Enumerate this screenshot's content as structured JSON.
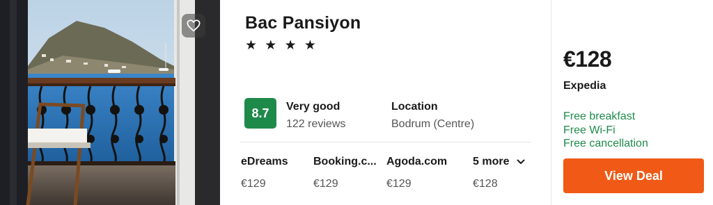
{
  "hotel": {
    "name": "Bac Pansiyon",
    "stars": "★ ★ ★ ★",
    "score": "8.7",
    "rating_label": "Very good",
    "reviews": "122 reviews",
    "location_label": "Location",
    "location_value": "Bodrum (Centre)"
  },
  "providers": [
    {
      "name": "eDreams",
      "price": "€129"
    },
    {
      "name": "Booking.c...",
      "price": "€129"
    },
    {
      "name": "Agoda.com",
      "price": "€129"
    },
    {
      "name": "5 more",
      "price": "€128"
    }
  ],
  "deal": {
    "price": "€128",
    "source": "Expedia",
    "perks": [
      "Free breakfast",
      "Free Wi-Fi",
      "Free cancellation"
    ],
    "button_label": "View Deal"
  },
  "icons": {
    "favorite": "heart-icon",
    "more": "chevron-down-icon"
  },
  "colors": {
    "score_bg": "#1e8a4a",
    "perk_text": "#1e8a4a",
    "deal_button": "#f05a16"
  }
}
